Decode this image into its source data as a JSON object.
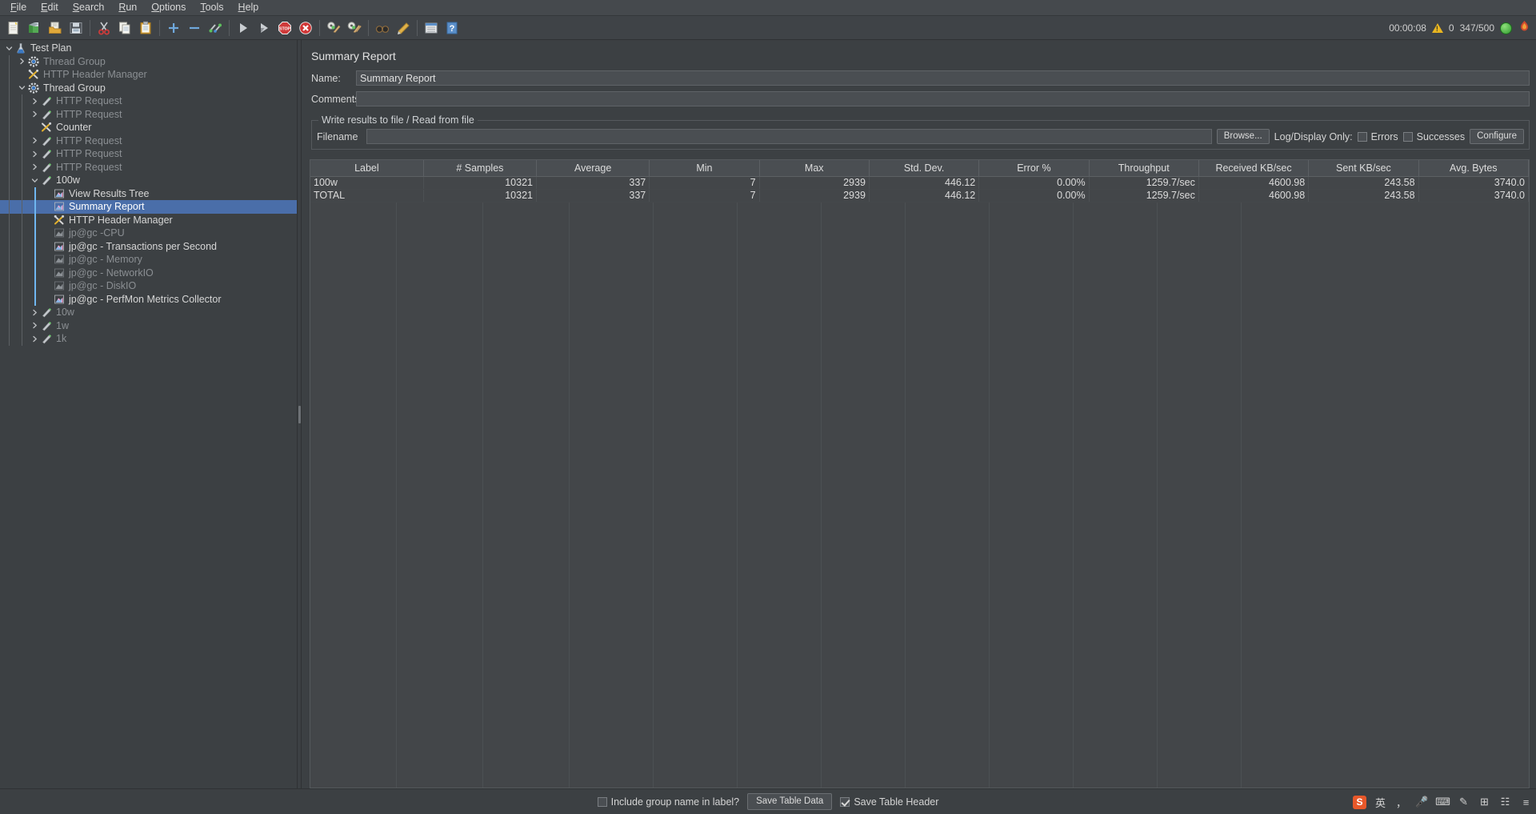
{
  "menu": {
    "items": [
      {
        "label": "File",
        "mnemonic": "F"
      },
      {
        "label": "Edit",
        "mnemonic": "E"
      },
      {
        "label": "Search",
        "mnemonic": "S"
      },
      {
        "label": "Run",
        "mnemonic": "R"
      },
      {
        "label": "Options",
        "mnemonic": "O"
      },
      {
        "label": "Tools",
        "mnemonic": "T"
      },
      {
        "label": "Help",
        "mnemonic": "H"
      }
    ]
  },
  "toolbar": {
    "buttons": [
      {
        "name": "new-icon",
        "tooltip": "New"
      },
      {
        "name": "templates-icon",
        "tooltip": "Templates"
      },
      {
        "name": "open-icon",
        "tooltip": "Open"
      },
      {
        "name": "save-icon",
        "tooltip": "Save Test Plan"
      },
      {
        "name": "cut-icon",
        "tooltip": "Cut"
      },
      {
        "name": "copy-icon",
        "tooltip": "Copy"
      },
      {
        "name": "paste-icon",
        "tooltip": "Paste"
      },
      {
        "name": "expand-all-icon",
        "tooltip": "Expand All"
      },
      {
        "name": "collapse-all-icon",
        "tooltip": "Collapse All"
      },
      {
        "name": "toggle-icon",
        "tooltip": "Toggle"
      },
      {
        "name": "start-icon",
        "tooltip": "Start"
      },
      {
        "name": "start-no-pauses-icon",
        "tooltip": "Start no pauses"
      },
      {
        "name": "stop-icon",
        "tooltip": "Stop"
      },
      {
        "name": "shutdown-icon",
        "tooltip": "Shutdown"
      },
      {
        "name": "clear-icon",
        "tooltip": "Clear"
      },
      {
        "name": "clear-all-icon",
        "tooltip": "Clear All"
      },
      {
        "name": "search-icon",
        "tooltip": "Search"
      },
      {
        "name": "reset-search-icon",
        "tooltip": "Reset Search"
      },
      {
        "name": "function-helper-icon",
        "tooltip": "Function Helper Dialog"
      },
      {
        "name": "help-icon",
        "tooltip": "Help"
      }
    ],
    "status": {
      "elapsed": "00:00:08",
      "warning_count": "0",
      "threads": "347/500"
    }
  },
  "tree": {
    "nodes": [
      {
        "label": "Test Plan",
        "depth": 0,
        "twisty": "down",
        "icon": "test-plan-icon",
        "dim": false,
        "selected": false
      },
      {
        "label": "Thread Group",
        "depth": 1,
        "twisty": "right",
        "icon": "thread-group-icon",
        "dim": true,
        "selected": false
      },
      {
        "label": "HTTP Header Manager",
        "depth": 1,
        "twisty": "none",
        "icon": "header-manager-icon",
        "dim": true,
        "selected": false
      },
      {
        "label": "Thread Group",
        "depth": 1,
        "twisty": "down",
        "icon": "thread-group-icon",
        "dim": false,
        "selected": false
      },
      {
        "label": "HTTP Request",
        "depth": 2,
        "twisty": "right",
        "icon": "http-request-icon",
        "dim": true,
        "selected": false
      },
      {
        "label": "HTTP Request",
        "depth": 2,
        "twisty": "right",
        "icon": "http-request-icon",
        "dim": true,
        "selected": false
      },
      {
        "label": "Counter",
        "depth": 2,
        "twisty": "none",
        "icon": "counter-icon",
        "dim": false,
        "selected": false
      },
      {
        "label": "HTTP Request",
        "depth": 2,
        "twisty": "right",
        "icon": "http-request-icon",
        "dim": true,
        "selected": false
      },
      {
        "label": "HTTP Request",
        "depth": 2,
        "twisty": "right",
        "icon": "http-request-icon",
        "dim": true,
        "selected": false
      },
      {
        "label": "HTTP Request",
        "depth": 2,
        "twisty": "right",
        "icon": "http-request-icon",
        "dim": true,
        "selected": false
      },
      {
        "label": "100w",
        "depth": 2,
        "twisty": "down",
        "icon": "http-request-icon",
        "dim": false,
        "selected": false
      },
      {
        "label": "View Results Tree",
        "depth": 3,
        "twisty": "none",
        "icon": "listener-icon",
        "dim": false,
        "selected": false
      },
      {
        "label": "Summary Report",
        "depth": 3,
        "twisty": "none",
        "icon": "listener-icon",
        "dim": false,
        "selected": true
      },
      {
        "label": "HTTP Header Manager",
        "depth": 3,
        "twisty": "none",
        "icon": "header-manager-icon",
        "dim": false,
        "selected": false
      },
      {
        "label": "jp@gc -CPU",
        "depth": 3,
        "twisty": "none",
        "icon": "listener-icon-dim",
        "dim": true,
        "selected": false
      },
      {
        "label": "jp@gc - Transactions per Second",
        "depth": 3,
        "twisty": "none",
        "icon": "listener-icon",
        "dim": false,
        "selected": false
      },
      {
        "label": "jp@gc - Memory",
        "depth": 3,
        "twisty": "none",
        "icon": "listener-icon-dim",
        "dim": true,
        "selected": false
      },
      {
        "label": "jp@gc - NetworkIO",
        "depth": 3,
        "twisty": "none",
        "icon": "listener-icon-dim",
        "dim": true,
        "selected": false
      },
      {
        "label": "jp@gc - DiskIO",
        "depth": 3,
        "twisty": "none",
        "icon": "listener-icon-dim",
        "dim": true,
        "selected": false
      },
      {
        "label": "jp@gc - PerfMon Metrics Collector",
        "depth": 3,
        "twisty": "none",
        "icon": "listener-icon",
        "dim": false,
        "selected": false
      },
      {
        "label": "10w",
        "depth": 2,
        "twisty": "right",
        "icon": "http-request-icon",
        "dim": true,
        "selected": false
      },
      {
        "label": "1w",
        "depth": 2,
        "twisty": "right",
        "icon": "http-request-icon",
        "dim": true,
        "selected": false
      },
      {
        "label": "1k",
        "depth": 2,
        "twisty": "right",
        "icon": "http-request-icon",
        "dim": true,
        "selected": false
      }
    ]
  },
  "panel": {
    "title": "Summary Report",
    "name_label": "Name:",
    "name_value": "Summary Report",
    "comments_label": "Comments:",
    "comments_value": "",
    "comments_placeholder": "",
    "group_legend": "Write results to file / Read from file",
    "filename_label": "Filename",
    "filename_value": "",
    "browse_label": "Browse...",
    "log_display_label": "Log/Display Only:",
    "errors_label": "Errors",
    "errors_checked": false,
    "successes_label": "Successes",
    "successes_checked": false,
    "configure_label": "Configure"
  },
  "chart_data": {
    "type": "table",
    "title": "Summary Report",
    "columns": [
      "Label",
      "# Samples",
      "Average",
      "Min",
      "Max",
      "Std. Dev.",
      "Error %",
      "Throughput",
      "Received KB/sec",
      "Sent KB/sec",
      "Avg. Bytes"
    ],
    "rows": [
      [
        "100w",
        "10321",
        "337",
        "7",
        "2939",
        "446.12",
        "0.00%",
        "1259.7/sec",
        "4600.98",
        "243.58",
        "3740.0"
      ],
      [
        "TOTAL",
        "10321",
        "337",
        "7",
        "2939",
        "446.12",
        "0.00%",
        "1259.7/sec",
        "4600.98",
        "243.58",
        "3740.0"
      ]
    ]
  },
  "bottom": {
    "include_group_label": "Include group name in label?",
    "include_group_checked": false,
    "save_table_data_label": "Save Table Data",
    "save_table_header_label": "Save Table Header",
    "save_table_header_checked": true
  },
  "tray": {
    "items": [
      {
        "name": "sogou-ime-icon",
        "glyph": "S"
      },
      {
        "name": "language-chinese-icon",
        "glyph": "英"
      },
      {
        "name": "punctuation-icon",
        "glyph": "，"
      },
      {
        "name": "microphone-icon",
        "glyph": "🎤"
      },
      {
        "name": "keyboard-icon",
        "glyph": "⌨"
      },
      {
        "name": "pencil-icon",
        "glyph": "✎"
      },
      {
        "name": "toolbox-icon",
        "glyph": "⊞"
      },
      {
        "name": "apps-icon",
        "glyph": "☷"
      },
      {
        "name": "menu-icon",
        "glyph": "≡"
      }
    ]
  },
  "colors": {
    "selection": "#4a6ea9",
    "accent_line": "#6fb6f0",
    "background": "#3c4043",
    "panel": "#434649",
    "header": "#4a4e52",
    "text": "#d4d4d4",
    "text_dim": "#8b8f93"
  }
}
